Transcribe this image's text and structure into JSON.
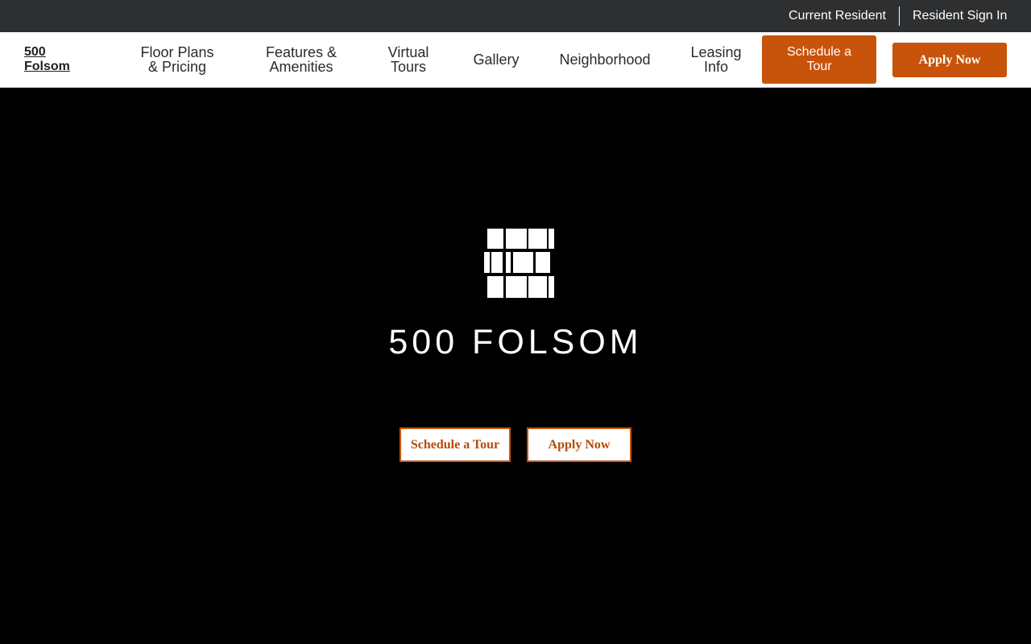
{
  "topbar": {
    "current_resident": "Current Resident",
    "resident_sign_in": "Resident Sign In"
  },
  "header": {
    "brand_line1": "500",
    "brand_line2": "Folsom",
    "nav": [
      {
        "line1": "Floor Plans",
        "line2": "& Pricing"
      },
      {
        "line1": "Features &",
        "line2": "Amenities"
      },
      {
        "line1": "Virtual",
        "line2": "Tours"
      },
      {
        "line1": "Gallery",
        "line2": ""
      },
      {
        "line1": "Neighborhood",
        "line2": ""
      },
      {
        "line1": "Leasing",
        "line2": "Info"
      }
    ],
    "schedule_label": "Schedule a Tour",
    "apply_label": "Apply Now"
  },
  "hero": {
    "logo_icon": "building-logo-icon",
    "logo_text": "500 FOLSOM",
    "schedule_label": "Schedule a Tour",
    "apply_label": "Apply Now"
  },
  "colors": {
    "accent": "#c8530a",
    "topbar_bg": "#2d2f31",
    "hero_bg": "#000000"
  }
}
